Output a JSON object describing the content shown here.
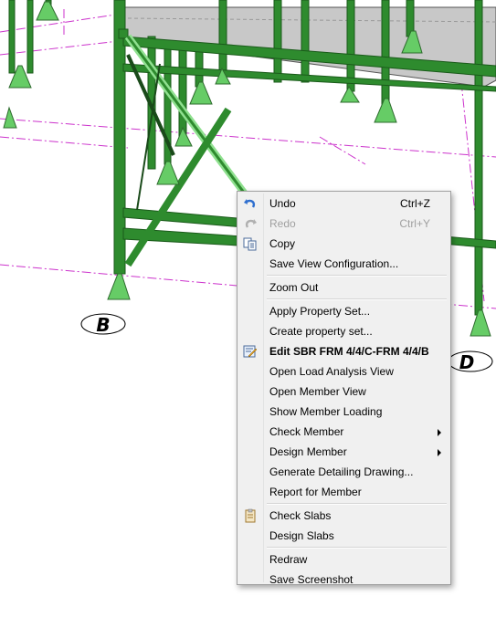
{
  "grid_labels": {
    "b": "B",
    "d": "D"
  },
  "colors": {
    "steel_dark": "#1f6b1f",
    "steel_light": "#3aa63a",
    "highlight": "#8fe08f",
    "base_plate": "#66cc66",
    "gridline": "#cc33cc",
    "slab": "#c8c8c8"
  },
  "menu": {
    "undo": "Undo",
    "undo_shortcut": "Ctrl+Z",
    "redo": "Redo",
    "redo_shortcut": "Ctrl+Y",
    "copy": "Copy",
    "save_view": "Save View Configuration...",
    "zoom_out": "Zoom Out",
    "apply_property": "Apply Property Set...",
    "create_property": "Create property set...",
    "edit_member": "Edit SBR FRM 4/4/C-FRM 4/4/B",
    "open_load": "Open Load Analysis View",
    "open_member": "Open Member View",
    "show_loading": "Show Member Loading",
    "check_member": "Check Member",
    "design_member": "Design Member",
    "generate_drawing": "Generate Detailing Drawing...",
    "report_member": "Report for Member",
    "check_slabs": "Check Slabs",
    "design_slabs": "Design Slabs",
    "redraw": "Redraw",
    "save_screenshot": "Save Screenshot"
  },
  "icons": {
    "undo": "undo-icon",
    "redo": "redo-icon",
    "copy": "copy-icon",
    "edit": "edit-member-icon",
    "check_slabs": "clipboard-icon"
  }
}
